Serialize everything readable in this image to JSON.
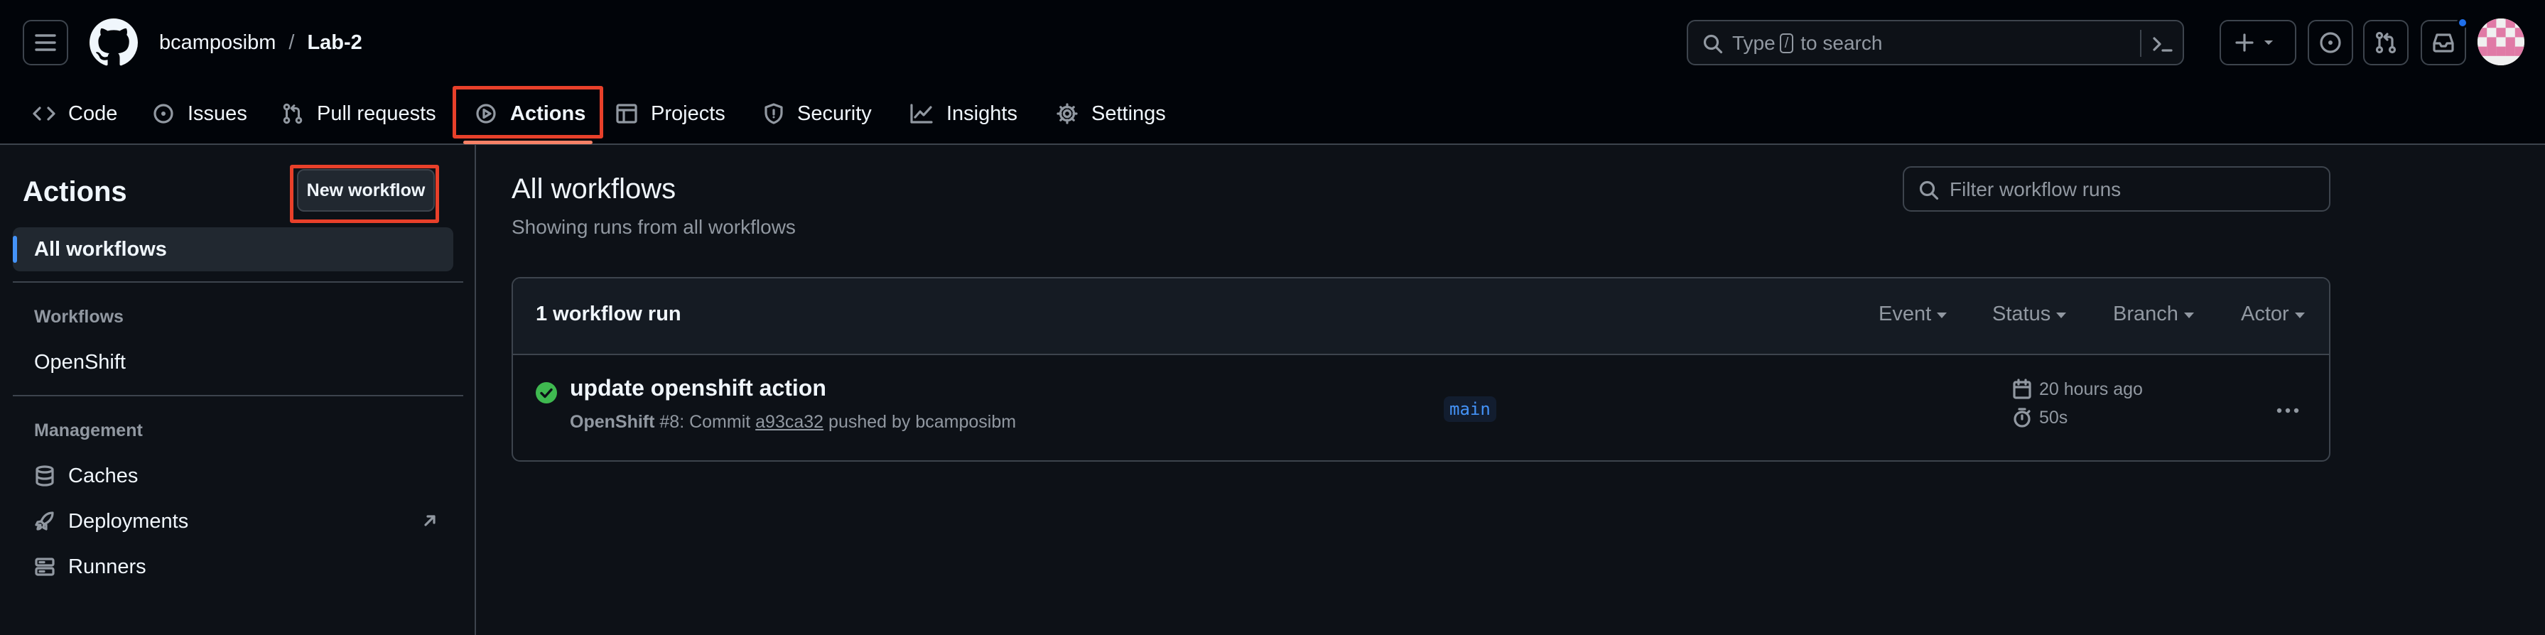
{
  "header": {
    "owner": "bcamposibm",
    "separator": "/",
    "repo": "Lab-2",
    "search": {
      "prefix": "Type",
      "key": "/",
      "suffix": "to search"
    },
    "notification_dot_color": "#1f6feb"
  },
  "repo_nav": {
    "items": [
      {
        "label": "Code",
        "icon": "code-icon"
      },
      {
        "label": "Issues",
        "icon": "issue-opened-icon"
      },
      {
        "label": "Pull requests",
        "icon": "git-pull-request-icon"
      },
      {
        "label": "Actions",
        "icon": "play-icon",
        "active": true
      },
      {
        "label": "Projects",
        "icon": "table-icon"
      },
      {
        "label": "Security",
        "icon": "shield-icon"
      },
      {
        "label": "Insights",
        "icon": "graph-icon"
      },
      {
        "label": "Settings",
        "icon": "gear-icon"
      }
    ],
    "active_underline_color": "#f78166",
    "highlight_color": "#e8402a"
  },
  "sidebar": {
    "title": "Actions",
    "new_workflow_label": "New workflow",
    "all_workflows_label": "All workflows",
    "workflows_heading": "Workflows",
    "workflows": [
      "OpenShift"
    ],
    "management_heading": "Management",
    "management_items": [
      {
        "label": "Caches",
        "icon": "database-icon"
      },
      {
        "label": "Deployments",
        "icon": "rocket-icon"
      },
      {
        "label": "Runners",
        "icon": "server-icon"
      }
    ]
  },
  "main": {
    "title": "All workflows",
    "subtitle": "Showing runs from all workflows",
    "filter_placeholder": "Filter workflow runs",
    "runs_count": "1 workflow run",
    "filters": [
      "Event",
      "Status",
      "Branch",
      "Actor"
    ],
    "runs": [
      {
        "status": "success",
        "status_color": "#3fb950",
        "title": "update openshift action",
        "workflow": "OpenShift",
        "run_number": "#8",
        "commit_prefix": ": Commit",
        "sha": "a93ca32",
        "pushed_by": "pushed by bcamposibm",
        "branch": "main",
        "time_ago": "20 hours ago",
        "duration": "50s"
      }
    ]
  }
}
